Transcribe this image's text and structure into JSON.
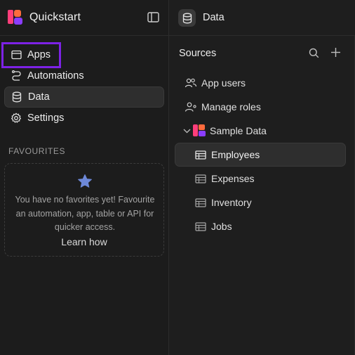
{
  "app": {
    "title": "Quickstart"
  },
  "sidebar": {
    "items": [
      {
        "label": "Apps",
        "icon": "browser-window-icon"
      },
      {
        "label": "Automations",
        "icon": "automation-path-icon"
      },
      {
        "label": "Data",
        "icon": "database-icon"
      },
      {
        "label": "Settings",
        "icon": "gear-icon"
      }
    ],
    "favourites": {
      "title": "FAVOURITES",
      "empty_message": "You have no favorites yet! Favourite an automation, app, table or API for quicker access.",
      "learn_how": "Learn how"
    }
  },
  "data_panel": {
    "header": "Data",
    "sources_title": "Sources",
    "items": [
      {
        "label": "App users",
        "icon": "users-icon"
      },
      {
        "label": "Manage roles",
        "icon": "user-roles-icon"
      },
      {
        "label": "Sample Data",
        "icon": "budibase-logo-icon"
      },
      {
        "label": "Employees",
        "icon": "table-icon"
      },
      {
        "label": "Expenses",
        "icon": "table-icon"
      },
      {
        "label": "Inventory",
        "icon": "table-icon"
      },
      {
        "label": "Jobs",
        "icon": "table-icon"
      }
    ]
  },
  "colors": {
    "background": "#1c1c1c",
    "highlight": "#7d22e6",
    "logo_pink": "#ff3e7b",
    "logo_orange": "#ff6b3d",
    "logo_purple": "#8b3dff",
    "star": "#6d88d8"
  }
}
